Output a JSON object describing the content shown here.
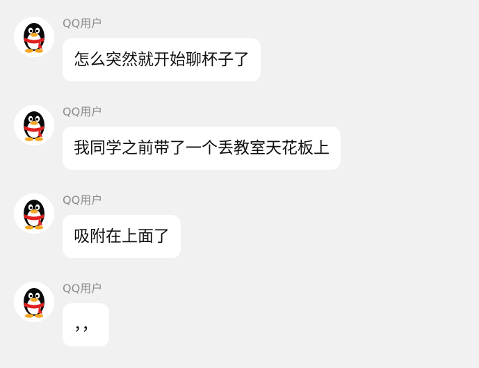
{
  "chat": {
    "messages": [
      {
        "sender": "QQ用户",
        "text": "怎么突然就开始聊杯子了",
        "avatar_icon": "qq-penguin-icon"
      },
      {
        "sender": "QQ用户",
        "text": "我同学之前带了一个丢教室天花板上",
        "avatar_icon": "qq-penguin-icon"
      },
      {
        "sender": "QQ用户",
        "text": "吸附在上面了",
        "avatar_icon": "qq-penguin-icon"
      },
      {
        "sender": "QQ用户",
        "text": "，，",
        "avatar_icon": "qq-penguin-icon"
      }
    ]
  },
  "colors": {
    "background": "#f1f1f1",
    "bubble": "#ffffff",
    "sender_name": "#8c8c8c",
    "message_text": "#111111",
    "penguin_scarf": "#e02020",
    "penguin_beak": "#f5a623"
  }
}
